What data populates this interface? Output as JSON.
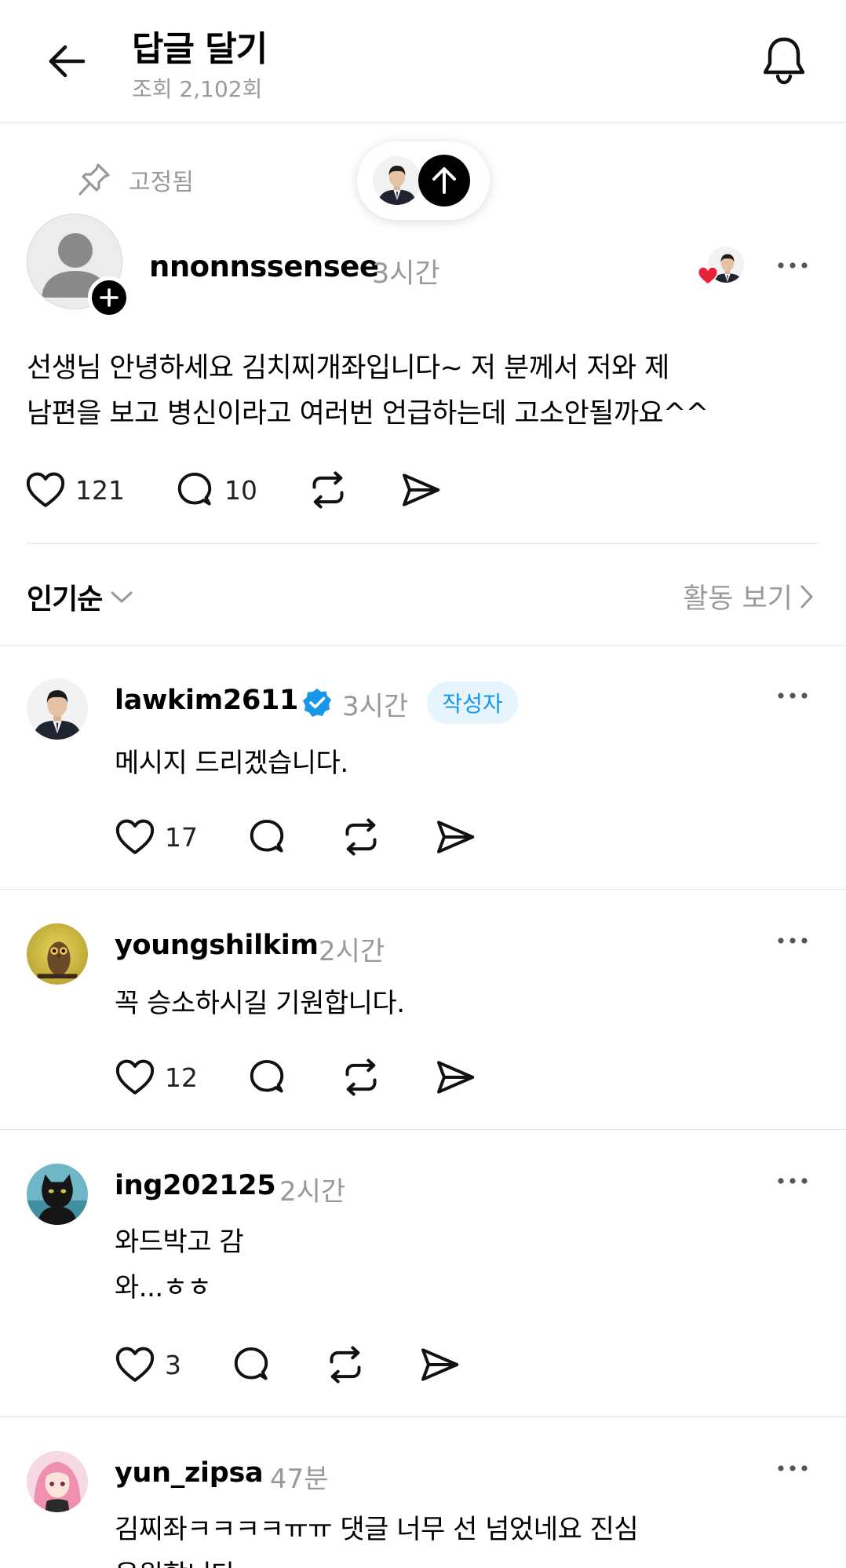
{
  "header": {
    "title": "답글 달기",
    "views": "조회 2,102회"
  },
  "pinned": {
    "label": "고정됨"
  },
  "post": {
    "username": "nnonnssensee",
    "time": "3시간",
    "lines": [
      "선생님 안녕하세요 김치찌개좌입니다~ 저 분께서 저와 제",
      "남편을 보고 병신이라고 여러번 언급하는데 고소안될까요^^"
    ],
    "likes": "121",
    "replies": "10"
  },
  "sort": {
    "label": "인기순",
    "activity": "활동 보기"
  },
  "comments": [
    {
      "username": "lawkim2611",
      "verified": true,
      "time": "3시간",
      "badge": "작성자",
      "lines": [
        "메시지 드리겠습니다."
      ],
      "likes": "17"
    },
    {
      "username": "youngshilkim",
      "time": "2시간",
      "lines": [
        "꼭 승소하시길 기원합니다."
      ],
      "likes": "12"
    },
    {
      "username": "ing202125",
      "time": "2시간",
      "lines": [
        "와드박고 감",
        "와...ㅎㅎ"
      ],
      "likes": "3"
    },
    {
      "username": "yun_zipsa",
      "time": "47분",
      "lines": [
        "김찌좌ㅋㅋㅋㅋㅠㅠ 댓글 너무 선 넘었네요 진심",
        "응원합니다"
      ]
    }
  ],
  "colors": {
    "verified": "#1896e8",
    "badge_bg": "#e5f4fd",
    "heart": "#e8223a",
    "muted": "#999999"
  }
}
